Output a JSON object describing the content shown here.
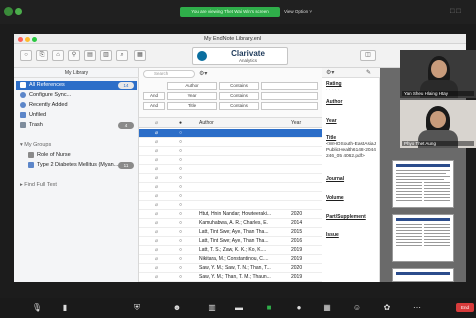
{
  "meeting": {
    "share_banner": "You are viewing Thet Wai Win's screen",
    "view_options": "View Option ˅"
  },
  "window": {
    "title": "My EndNote Library.enl"
  },
  "toolbar": {
    "clarivate_name": "Clarivate",
    "clarivate_sub": "Analytics"
  },
  "sidebar": {
    "header": "My Library",
    "items": [
      {
        "label": "All References",
        "count": "14",
        "selected": true
      },
      {
        "label": "Configure Sync...",
        "count": ""
      },
      {
        "label": "Recently Added",
        "count": ""
      },
      {
        "label": "Unfiled",
        "count": ""
      },
      {
        "label": "Trash",
        "count": "4"
      }
    ],
    "my_groups": "My Groups",
    "groups": [
      {
        "label": "Role of Nurse",
        "count": ""
      },
      {
        "label": "Type 2 Diabetes Mellitus (Myan...",
        "count": "11"
      }
    ],
    "find_full_text": "Find Full Text"
  },
  "search": {
    "placeholder": "Search",
    "rows": [
      {
        "bool": "",
        "field": "Author",
        "op": "Contains"
      },
      {
        "bool": "And",
        "field": "Year",
        "op": "Contains"
      },
      {
        "bool": "And",
        "field": "Title",
        "op": "Contains"
      }
    ]
  },
  "list": {
    "col_author": "Author",
    "col_year": "Year",
    "rows": [
      {
        "author": "",
        "year": "",
        "selected": true
      },
      {
        "author": "",
        "year": ""
      },
      {
        "author": "",
        "year": ""
      },
      {
        "author": "",
        "year": ""
      },
      {
        "author": "",
        "year": ""
      },
      {
        "author": "",
        "year": ""
      },
      {
        "author": "",
        "year": ""
      },
      {
        "author": "",
        "year": ""
      },
      {
        "author": "",
        "year": ""
      },
      {
        "author": "Htut, Hnin Nandar; Howteeraki...",
        "year": "2020"
      },
      {
        "author": "Kamuhabwa, A. R.; Charles, E.",
        "year": "2014"
      },
      {
        "author": "Latt, Tint Swe; Aye, Than Tha...",
        "year": "2015"
      },
      {
        "author": "Latt, Tint Swe; Aye, Than Tha...",
        "year": "2016"
      },
      {
        "author": "Latt, T. S.; Zaw, K. K.; Ko, K....",
        "year": "2019"
      },
      {
        "author": "Nikitara, M.; Constantinou, C....",
        "year": "2019"
      },
      {
        "author": "Saw, Y. M.; Saw, T. N.; Than, T...",
        "year": "2020"
      },
      {
        "author": "Saw, Y. M.; Than, T. M.; Thaun...",
        "year": "2019"
      }
    ]
  },
  "detail": {
    "rating_label": "Rating",
    "rating_value": "· · · · ·",
    "author_label": "Author",
    "year_label": "Year",
    "title_label": "Title",
    "title_value": "<WHOSouth-EastAsiaJPublicHealth6148-2044246_05 4062.pdf>",
    "journal_label": "Journal",
    "volume_label": "Volume",
    "part_label": "Part/Supplement",
    "issue_label": "Issue"
  },
  "participants": [
    {
      "name": "Yan Sheu Hlaing Htay"
    },
    {
      "name": "Phyo Thet Aung"
    }
  ],
  "colors": {
    "selection": "#2c6ec8",
    "share_banner": "#2fae4a",
    "end_button": "#d63b3b"
  },
  "bottom": {
    "end": "End"
  }
}
